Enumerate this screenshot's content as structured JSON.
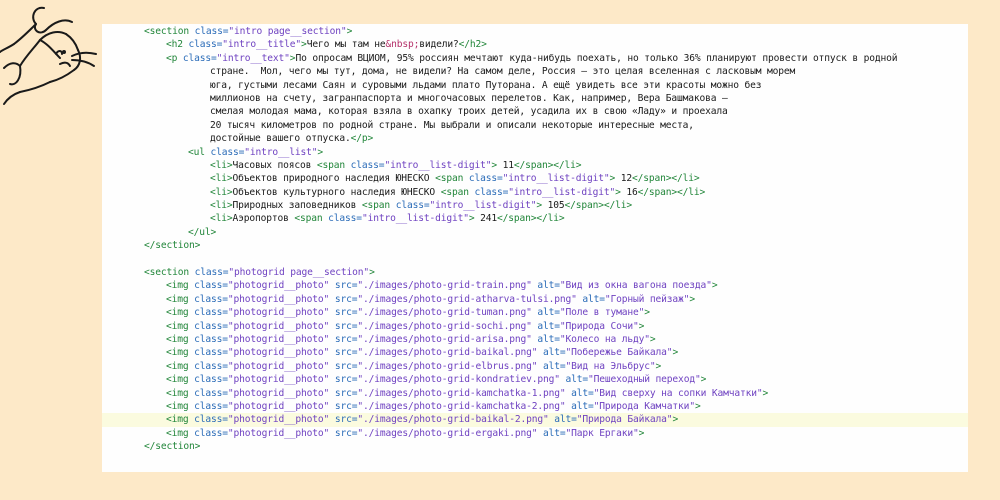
{
  "colors": {
    "background": "#fde9c8",
    "editor_background": "#fefefe",
    "highlight_line": "#fbfbdf",
    "tag": "#22863a",
    "attribute": "#2b6cb8",
    "string": "#6f42c1",
    "entity": "#b5316a",
    "text": "#1a1a1a"
  },
  "logo": {
    "icon": "mouse-head-sketch-icon"
  },
  "code": {
    "highlighted_line": 29,
    "lines": [
      [
        [
          "t",
          "<section "
        ],
        [
          "a",
          "class="
        ],
        [
          "s",
          "\"intro page__section\""
        ],
        [
          "t",
          ">"
        ]
      ],
      [
        [
          "t",
          "<h2 "
        ],
        [
          "a",
          "class="
        ],
        [
          "s",
          "\"intro__title\""
        ],
        [
          "t",
          ">"
        ],
        [
          "x",
          "Чего мы там не"
        ],
        [
          "e",
          "&nbsp;"
        ],
        [
          "x",
          "видели?"
        ],
        [
          "t",
          "</h2>"
        ]
      ],
      [
        [
          "t",
          "<p "
        ],
        [
          "a",
          "class="
        ],
        [
          "s",
          "\"intro__text\""
        ],
        [
          "t",
          ">"
        ],
        [
          "x",
          "По опросам ВЦИОМ, 95% россиян мечтают куда-нибудь поехать, но только 36% планируют провести отпуск в родной"
        ]
      ],
      [
        [
          "x",
          "стране.  Мол, чего мы тут, дома, не видели? На самом деле, Россия — это целая вселенная с ласковым морем"
        ]
      ],
      [
        [
          "x",
          "юга, густыми лесами Саян и суровыми льдами плато Путорана. А ещё увидеть все эти красоты можно без"
        ]
      ],
      [
        [
          "x",
          "миллионов на счету, загранпаспорта и многочасовых перелетов. Как, например, Вера Башмакова —"
        ]
      ],
      [
        [
          "x",
          "смелая молодая мама, которая взяла в охапку троих детей, усадила их в свою «Ладу» и проехала"
        ]
      ],
      [
        [
          "x",
          "20 тысяч километров по родной стране. Мы выбрали и описали некоторые интересные места,"
        ]
      ],
      [
        [
          "x",
          "достойные вашего отпуска."
        ],
        [
          "t",
          "</p>"
        ]
      ],
      [
        [
          "t",
          "<ul "
        ],
        [
          "a",
          "class="
        ],
        [
          "s",
          "\"intro__list\""
        ],
        [
          "t",
          ">"
        ]
      ],
      [
        [
          "t",
          "<li>"
        ],
        [
          "x",
          "Часовых поясов "
        ],
        [
          "t",
          "<span "
        ],
        [
          "a",
          "class="
        ],
        [
          "s",
          "\"intro__list-digit\""
        ],
        [
          "t",
          "> "
        ],
        [
          "x",
          "11"
        ],
        [
          "t",
          "</span></li>"
        ]
      ],
      [
        [
          "t",
          "<li>"
        ],
        [
          "x",
          "Объектов природного наследия ЮНЕСКО "
        ],
        [
          "t",
          "<span "
        ],
        [
          "a",
          "class="
        ],
        [
          "s",
          "\"intro__list-digit\""
        ],
        [
          "t",
          "> "
        ],
        [
          "x",
          "12"
        ],
        [
          "t",
          "</span></li>"
        ]
      ],
      [
        [
          "t",
          "<li>"
        ],
        [
          "x",
          "Объектов культурного наследия ЮНЕСКО "
        ],
        [
          "t",
          "<span "
        ],
        [
          "a",
          "class="
        ],
        [
          "s",
          "\"intro__list-digit\""
        ],
        [
          "t",
          "> "
        ],
        [
          "x",
          "16"
        ],
        [
          "t",
          "</span></li>"
        ]
      ],
      [
        [
          "t",
          "<li>"
        ],
        [
          "x",
          "Природных заповедников "
        ],
        [
          "t",
          "<span "
        ],
        [
          "a",
          "class="
        ],
        [
          "s",
          "\"intro__list-digit\""
        ],
        [
          "t",
          "> "
        ],
        [
          "x",
          "105"
        ],
        [
          "t",
          "</span></li>"
        ]
      ],
      [
        [
          "t",
          "<li>"
        ],
        [
          "x",
          "Аэропортов "
        ],
        [
          "t",
          "<span "
        ],
        [
          "a",
          "class="
        ],
        [
          "s",
          "\"intro__list-digit\""
        ],
        [
          "t",
          "> "
        ],
        [
          "x",
          "241"
        ],
        [
          "t",
          "</span></li>"
        ]
      ],
      [
        [
          "t",
          "</ul>"
        ]
      ],
      [
        [
          "t",
          "</section>"
        ]
      ],
      [],
      [
        [
          "t",
          "<section "
        ],
        [
          "a",
          "class="
        ],
        [
          "s",
          "\"photogrid page__section\""
        ],
        [
          "t",
          ">"
        ]
      ],
      [
        [
          "t",
          "<img "
        ],
        [
          "a",
          "class="
        ],
        [
          "s",
          "\"photogrid__photo\""
        ],
        [
          "x",
          " "
        ],
        [
          "a",
          "src="
        ],
        [
          "s",
          "\"./images/photo-grid-train.png\""
        ],
        [
          "x",
          " "
        ],
        [
          "a",
          "alt="
        ],
        [
          "s",
          "\"Вид из окна вагона поезда\""
        ],
        [
          "t",
          ">"
        ]
      ],
      [
        [
          "t",
          "<img "
        ],
        [
          "a",
          "class="
        ],
        [
          "s",
          "\"photogrid__photo\""
        ],
        [
          "x",
          " "
        ],
        [
          "a",
          "src="
        ],
        [
          "s",
          "\"./images/photo-grid-atharva-tulsi.png\""
        ],
        [
          "x",
          " "
        ],
        [
          "a",
          "alt="
        ],
        [
          "s",
          "\"Горный пейзаж\""
        ],
        [
          "t",
          ">"
        ]
      ],
      [
        [
          "t",
          "<img "
        ],
        [
          "a",
          "class="
        ],
        [
          "s",
          "\"photogrid__photo\""
        ],
        [
          "x",
          " "
        ],
        [
          "a",
          "src="
        ],
        [
          "s",
          "\"./images/photo-grid-tuman.png\""
        ],
        [
          "x",
          " "
        ],
        [
          "a",
          "alt="
        ],
        [
          "s",
          "\"Поле в тумане\""
        ],
        [
          "t",
          ">"
        ]
      ],
      [
        [
          "t",
          "<img "
        ],
        [
          "a",
          "class="
        ],
        [
          "s",
          "\"photogrid__photo\""
        ],
        [
          "x",
          " "
        ],
        [
          "a",
          "src="
        ],
        [
          "s",
          "\"./images/photo-grid-sochi.png\""
        ],
        [
          "x",
          " "
        ],
        [
          "a",
          "alt="
        ],
        [
          "s",
          "\"Природа Сочи\""
        ],
        [
          "t",
          ">"
        ]
      ],
      [
        [
          "t",
          "<img "
        ],
        [
          "a",
          "class="
        ],
        [
          "s",
          "\"photogrid__photo\""
        ],
        [
          "x",
          " "
        ],
        [
          "a",
          "src="
        ],
        [
          "s",
          "\"./images/photo-grid-arisa.png\""
        ],
        [
          "x",
          " "
        ],
        [
          "a",
          "alt="
        ],
        [
          "s",
          "\"Колесо на льду\""
        ],
        [
          "t",
          ">"
        ]
      ],
      [
        [
          "t",
          "<img "
        ],
        [
          "a",
          "class="
        ],
        [
          "s",
          "\"photogrid__photo\""
        ],
        [
          "x",
          " "
        ],
        [
          "a",
          "src="
        ],
        [
          "s",
          "\"./images/photo-grid-baikal.png\""
        ],
        [
          "x",
          " "
        ],
        [
          "a",
          "alt="
        ],
        [
          "s",
          "\"Побережье Байкала\""
        ],
        [
          "t",
          ">"
        ]
      ],
      [
        [
          "t",
          "<img "
        ],
        [
          "a",
          "class="
        ],
        [
          "s",
          "\"photogrid__photo\""
        ],
        [
          "x",
          " "
        ],
        [
          "a",
          "src="
        ],
        [
          "s",
          "\"./images/photo-grid-elbrus.png\""
        ],
        [
          "x",
          " "
        ],
        [
          "a",
          "alt="
        ],
        [
          "s",
          "\"Вид на Эльбрус\""
        ],
        [
          "t",
          ">"
        ]
      ],
      [
        [
          "t",
          "<img "
        ],
        [
          "a",
          "class="
        ],
        [
          "s",
          "\"photogrid__photo\""
        ],
        [
          "x",
          " "
        ],
        [
          "a",
          "src="
        ],
        [
          "s",
          "\"./images/photo-grid-kondratiev.png\""
        ],
        [
          "x",
          " "
        ],
        [
          "a",
          "alt="
        ],
        [
          "s",
          "\"Пешеходный переход\""
        ],
        [
          "t",
          ">"
        ]
      ],
      [
        [
          "t",
          "<img "
        ],
        [
          "a",
          "class="
        ],
        [
          "s",
          "\"photogrid__photo\""
        ],
        [
          "x",
          " "
        ],
        [
          "a",
          "src="
        ],
        [
          "s",
          "\"./images/photo-grid-kamchatka-1.png\""
        ],
        [
          "x",
          " "
        ],
        [
          "a",
          "alt="
        ],
        [
          "s",
          "\"Вид сверху на сопки Камчатки\""
        ],
        [
          "t",
          ">"
        ]
      ],
      [
        [
          "t",
          "<img "
        ],
        [
          "a",
          "class="
        ],
        [
          "s",
          "\"photogrid__photo\""
        ],
        [
          "x",
          " "
        ],
        [
          "a",
          "src="
        ],
        [
          "s",
          "\"./images/photo-grid-kamchatka-2.png\""
        ],
        [
          "x",
          " "
        ],
        [
          "a",
          "alt="
        ],
        [
          "s",
          "\"Природа Камчатки\""
        ],
        [
          "t",
          ">"
        ]
      ],
      [
        [
          "t",
          "<img "
        ],
        [
          "a",
          "class="
        ],
        [
          "s",
          "\"photogrid__photo\""
        ],
        [
          "x",
          " "
        ],
        [
          "a",
          "src="
        ],
        [
          "s",
          "\"./images/photo-grid-baikal-2.png\""
        ],
        [
          "x",
          " "
        ],
        [
          "a",
          "alt="
        ],
        [
          "s",
          "\"Природа Байкала\""
        ],
        [
          "t",
          ">"
        ]
      ],
      [
        [
          "t",
          "<img "
        ],
        [
          "a",
          "class="
        ],
        [
          "s",
          "\"photogrid__photo\""
        ],
        [
          "x",
          " "
        ],
        [
          "a",
          "src="
        ],
        [
          "s",
          "\"./images/photo-grid-ergaki.png\""
        ],
        [
          "x",
          " "
        ],
        [
          "a",
          "alt="
        ],
        [
          "s",
          "\"Парк Ергаки\""
        ],
        [
          "t",
          ">"
        ]
      ],
      [
        [
          "t",
          "</section>"
        ]
      ]
    ]
  }
}
